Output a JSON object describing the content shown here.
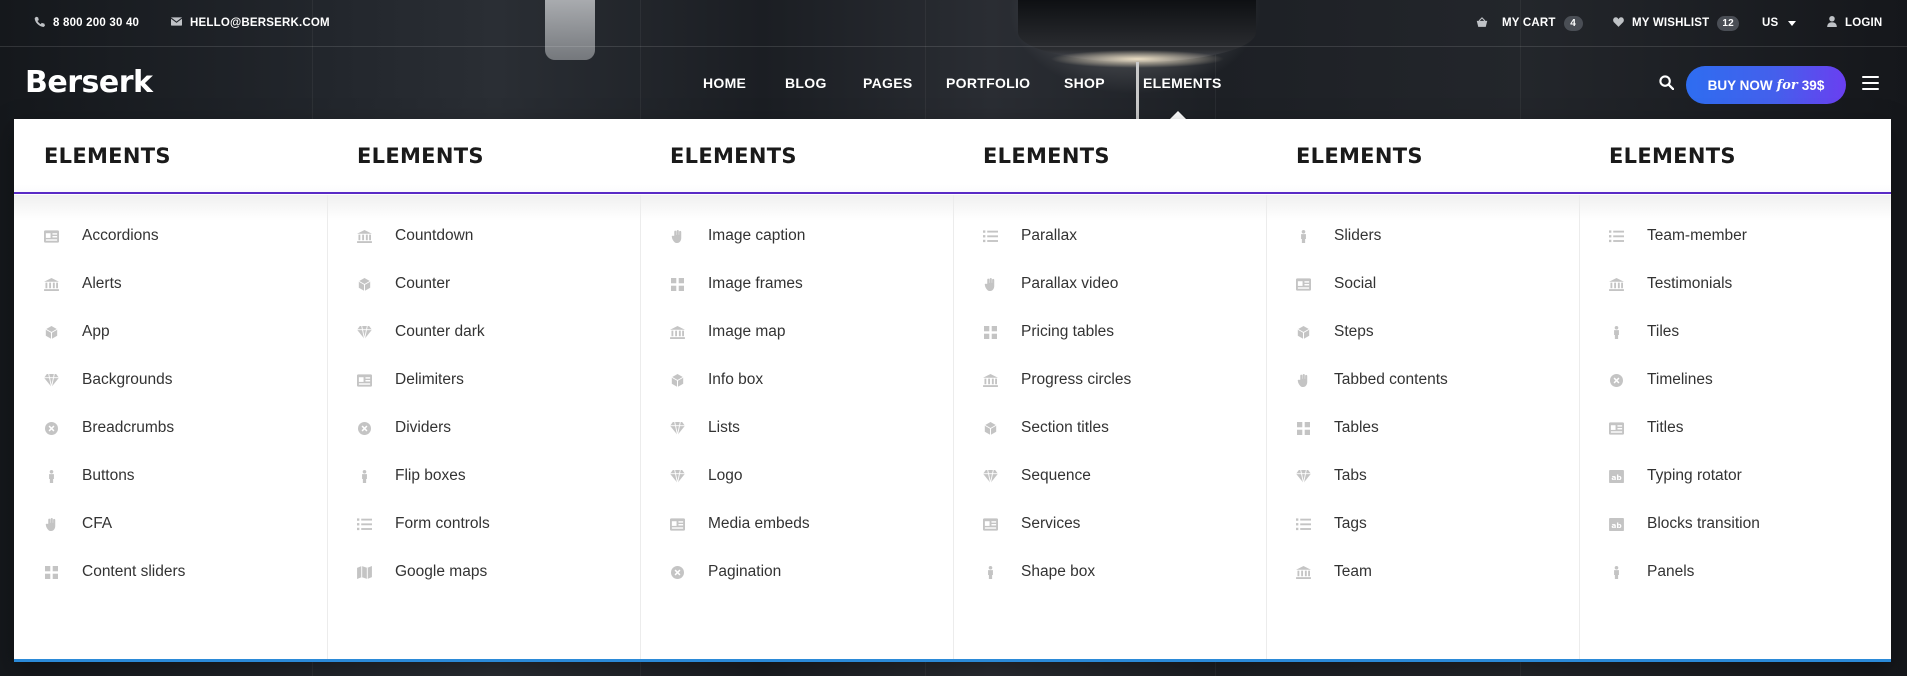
{
  "topbar": {
    "phone": "8 800 200 30 40",
    "email": "HELLO@BERSERK.COM",
    "cart_label": "MY CART",
    "cart_count": "4",
    "wishlist_label": "MY WISHLIST",
    "wishlist_count": "12",
    "language": "US",
    "login_label": "LOGIN"
  },
  "header": {
    "logo_text": "Berserk",
    "nav": [
      "HOME",
      "BLOG",
      "PAGES",
      "PORTFOLIO",
      "SHOP",
      "ELEMENTS"
    ],
    "buy_now": "BUY NOW",
    "buy_for": "for",
    "buy_price": "39$"
  },
  "colors": {
    "accent_blue": "#2e6df0",
    "accent_purple": "#5a2bc6",
    "menu_bottom_border": "#2b8ad8"
  },
  "mega_menu": {
    "columns": [
      {
        "title": "ELEMENTS",
        "items": [
          {
            "label": "Accordions",
            "icon": "id-card-icon"
          },
          {
            "label": "Alerts",
            "icon": "bank-icon"
          },
          {
            "label": "App",
            "icon": "cube-icon"
          },
          {
            "label": "Backgrounds",
            "icon": "diamond-icon"
          },
          {
            "label": "Breadcrumbs",
            "icon": "close-circle-icon"
          },
          {
            "label": "Buttons",
            "icon": "person-icon"
          },
          {
            "label": "CFA",
            "icon": "hand-icon"
          },
          {
            "label": "Content sliders",
            "icon": "grid-icon"
          }
        ]
      },
      {
        "title": "ELEMENTS",
        "items": [
          {
            "label": "Countdown",
            "icon": "bank-icon"
          },
          {
            "label": "Counter",
            "icon": "cube-icon"
          },
          {
            "label": "Counter dark",
            "icon": "diamond-icon"
          },
          {
            "label": "Delimiters",
            "icon": "id-card-icon"
          },
          {
            "label": "Dividers",
            "icon": "close-circle-icon"
          },
          {
            "label": "Flip boxes",
            "icon": "person-icon"
          },
          {
            "label": "Form controls",
            "icon": "list-icon"
          },
          {
            "label": "Google maps",
            "icon": "map-icon"
          }
        ]
      },
      {
        "title": "ELEMENTS",
        "items": [
          {
            "label": "Image caption",
            "icon": "hand-icon"
          },
          {
            "label": "Image frames",
            "icon": "grid-icon"
          },
          {
            "label": "Image map",
            "icon": "bank-icon"
          },
          {
            "label": "Info box",
            "icon": "cube-icon"
          },
          {
            "label": "Lists",
            "icon": "diamond-icon"
          },
          {
            "label": "Logo",
            "icon": "diamond-icon"
          },
          {
            "label": "Media embeds",
            "icon": "id-card-icon"
          },
          {
            "label": "Pagination",
            "icon": "close-circle-icon"
          }
        ]
      },
      {
        "title": "ELEMENTS",
        "items": [
          {
            "label": "Parallax",
            "icon": "list-icon"
          },
          {
            "label": "Parallax video",
            "icon": "hand-icon"
          },
          {
            "label": "Pricing tables",
            "icon": "grid-icon"
          },
          {
            "label": "Progress circles",
            "icon": "bank-icon"
          },
          {
            "label": "Section titles",
            "icon": "cube-icon"
          },
          {
            "label": "Sequence",
            "icon": "diamond-icon"
          },
          {
            "label": "Services",
            "icon": "id-card-icon"
          },
          {
            "label": "Shape box",
            "icon": "person-icon"
          }
        ]
      },
      {
        "title": "ELEMENTS",
        "items": [
          {
            "label": "Sliders",
            "icon": "person-icon"
          },
          {
            "label": "Social",
            "icon": "id-card-icon"
          },
          {
            "label": "Steps",
            "icon": "cube-icon"
          },
          {
            "label": "Tabbed contents",
            "icon": "hand-icon"
          },
          {
            "label": "Tables",
            "icon": "grid-icon"
          },
          {
            "label": "Tabs",
            "icon": "diamond-icon"
          },
          {
            "label": "Tags",
            "icon": "list-icon"
          },
          {
            "label": "Team",
            "icon": "bank-icon"
          }
        ]
      },
      {
        "title": "ELEMENTS",
        "items": [
          {
            "label": "Team-member",
            "icon": "list-icon"
          },
          {
            "label": "Testimonials",
            "icon": "bank-icon"
          },
          {
            "label": "Tiles",
            "icon": "person-icon"
          },
          {
            "label": "Timelines",
            "icon": "close-circle-icon"
          },
          {
            "label": "Titles",
            "icon": "id-card-icon"
          },
          {
            "label": "Typing rotator",
            "icon": "font-icon"
          },
          {
            "label": "Blocks transition",
            "icon": "font-icon"
          },
          {
            "label": "Panels",
            "icon": "person-icon"
          }
        ]
      }
    ]
  }
}
